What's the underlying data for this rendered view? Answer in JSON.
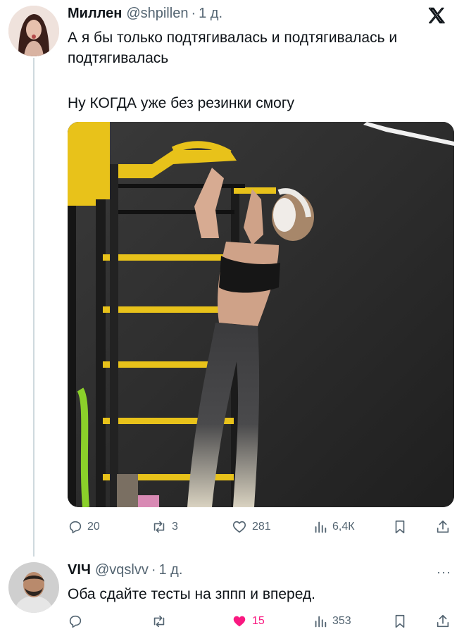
{
  "tweet1": {
    "author_name": "Миллен",
    "handle": "@shpillen",
    "separator": "·",
    "time": "1 д.",
    "text_line1": "А я бы только подтягивалась и подтягивалась и",
    "text_line2": "подтягивалась",
    "text_line3": "Ну КОГДА уже без резинки смогу",
    "actions": {
      "replies": "20",
      "reposts": "3",
      "likes": "281",
      "views": "6,4К"
    }
  },
  "tweet2": {
    "author_name": "VIЧ",
    "handle": "@vqslvv",
    "separator": "·",
    "time": "1 д.",
    "more": "···",
    "text": "Оба сдайте тесты на зппп и вперед.",
    "actions": {
      "replies": "",
      "reposts": "",
      "likes": "15",
      "views": "353",
      "liked": true
    }
  },
  "icons": [
    "x-logo-icon",
    "reply-icon",
    "repost-icon",
    "like-icon",
    "views-icon",
    "bookmark-icon",
    "share-icon",
    "more-icon"
  ],
  "colors": {
    "text": "#0f1419",
    "secondary": "#536471",
    "like_active": "#f91880",
    "thread_line": "#cfd9de",
    "gym_yellow": "#e8c21a"
  }
}
